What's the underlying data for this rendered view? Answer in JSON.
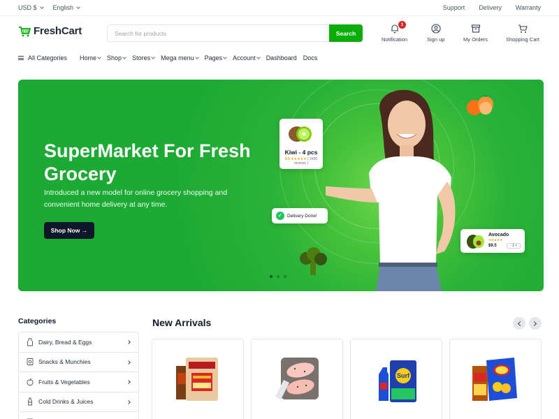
{
  "topbar": {
    "currency": "USD $",
    "language": "English",
    "links": [
      "Support",
      "Delivery",
      "Warranty"
    ]
  },
  "header": {
    "logo_text": "FreshCart",
    "search_placeholder": "Search for products",
    "search_button": "Search",
    "icons": [
      {
        "name": "bell-icon",
        "label": "Notification",
        "badge": "1"
      },
      {
        "name": "user-icon",
        "label": "Sign up"
      },
      {
        "name": "box-icon",
        "label": "My Orders"
      },
      {
        "name": "cart-icon",
        "label": "Shopping Cart"
      }
    ]
  },
  "nav": {
    "all_categories": "All Categories",
    "items": [
      "Home",
      "Shop",
      "Stores",
      "Mega menu",
      "Pages",
      "Account",
      "Dashboard",
      "Docs"
    ]
  },
  "hero": {
    "title": "SuperMarket For Fresh Grocery",
    "subtitle": "Introduced a new model for online grocery shopping and convenient home delivery at any time.",
    "button": "Shop Now →",
    "kiwi_card": {
      "title": "Kiwi - 4 pcs",
      "rating": "4.9",
      "reviews": "( 2450 reviews )"
    },
    "delivery_badge": "Delivery Done!",
    "avocado_card": {
      "title": "Avocado",
      "price": "$9.5",
      "qty": "- 1 +"
    },
    "slides": 3,
    "active_slide": 1
  },
  "categories": {
    "title": "Categories",
    "items": [
      {
        "label": "Dairy, Bread & Eggs",
        "icon": "milk-icon"
      },
      {
        "label": "Snacks & Munchies",
        "icon": "snack-icon"
      },
      {
        "label": "Fruits & Vegetables",
        "icon": "apple-icon"
      },
      {
        "label": "Cold Drinks & Juices",
        "icon": "bottle-icon"
      }
    ]
  },
  "new_arrivals": {
    "title": "New Arrivals",
    "products": [
      {
        "image": "atta-flour-bag"
      },
      {
        "image": "raw-chicken"
      },
      {
        "image": "detergent-pack"
      },
      {
        "image": "chips-and-noodles"
      }
    ]
  },
  "colors": {
    "brand_green": "#0aad0a",
    "hero_green": "#22b03a",
    "dark": "#0f172a",
    "badge_red": "#dc2626"
  }
}
